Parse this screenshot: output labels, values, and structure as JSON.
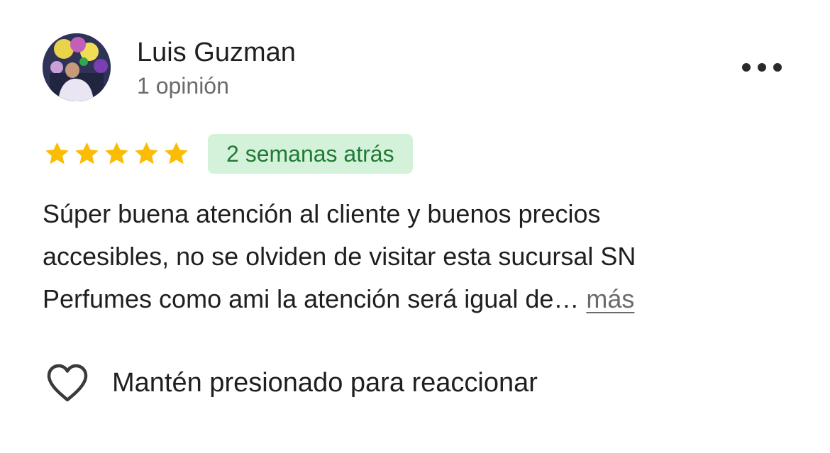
{
  "review": {
    "author": {
      "name": "Luis Guzman",
      "meta": "1 opinión",
      "avatar_icon": "profile-photo"
    },
    "options_icon": "more-horizontal-icon",
    "rating": {
      "stars": 5,
      "max": 5,
      "star_color": "#fbbc04"
    },
    "date": "2 semanas atrás",
    "badge_colors": {
      "background": "#d4f1da",
      "text": "#1f7a35"
    },
    "text_lines": [
      "Súper buena atención al cliente y buenos precios",
      "accesibles, no se olviden de visitar esta sucursal SN",
      "Perfumes como ami la atención será igual de…"
    ],
    "more_label": "más",
    "reaction": {
      "icon": "heart-outline-icon",
      "label": "Mantén presionado para reaccionar"
    }
  }
}
